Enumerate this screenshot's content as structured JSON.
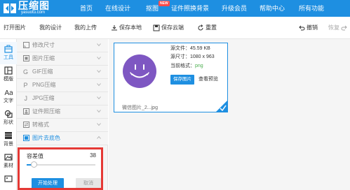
{
  "brand": {
    "title": "压缩图",
    "subtitle": "yasuotu.com",
    "accent": "#1e8fe1"
  },
  "nav": {
    "items": [
      "首页",
      "在线设计",
      "抠图",
      "证件照换背景",
      "升级会员",
      "帮助中心",
      "所有功能"
    ],
    "new_badge": "NEW"
  },
  "toolbar": {
    "open_image": "打开图片",
    "my_designs": "我的设计",
    "my_uploads": "我的上传",
    "save_local": "保存本地",
    "save_cloud": "保存云端",
    "reset": "重置",
    "undo": "撤销",
    "redo": "恢复"
  },
  "rail": {
    "items": [
      {
        "label": "工具",
        "icon": "toolbox-icon"
      },
      {
        "label": "模版",
        "icon": "template-icon"
      },
      {
        "label": "文字",
        "icon": "text-icon"
      },
      {
        "label": "形状",
        "icon": "shape-icon"
      },
      {
        "label": "背景",
        "icon": "background-icon"
      },
      {
        "label": "素材",
        "icon": "material-icon"
      },
      {
        "label": "",
        "icon": "image-icon"
      }
    ]
  },
  "panel": {
    "items": [
      {
        "label": "修改尺寸",
        "icon": "resize-icon"
      },
      {
        "label": "图片压缩",
        "icon": "compress-icon"
      },
      {
        "label": "GIF压缩",
        "icon": "gif-icon"
      },
      {
        "label": "PNG压缩",
        "icon": "png-icon"
      },
      {
        "label": "JPG压缩",
        "icon": "jpg-icon"
      },
      {
        "label": "证件照压缩",
        "icon": "id-photo-icon"
      },
      {
        "label": "转格式",
        "icon": "convert-icon"
      },
      {
        "label": "图片去底色",
        "icon": "remove-bg-icon"
      }
    ],
    "active_index": 7,
    "settings": {
      "tolerance_label": "容差值",
      "tolerance_value": "38",
      "tolerance_fraction": 0.1,
      "start_button": "开始处理",
      "cancel_button": "取消"
    }
  },
  "image_card": {
    "source_file_label": "源文件：",
    "source_file_value": "45.59 KB",
    "source_size_label": "源尺寸：",
    "source_size_value": "1080 x 963",
    "current_format_label": "当前格式：",
    "current_format_value": "png",
    "save_button": "保存图片",
    "preview_link": "查看预览",
    "filename": "微信图片_2...jpg",
    "selected": true
  },
  "colors": {
    "highlight": "#e53935",
    "avatar": "#7e57c2",
    "format_value": "#4caf50"
  }
}
